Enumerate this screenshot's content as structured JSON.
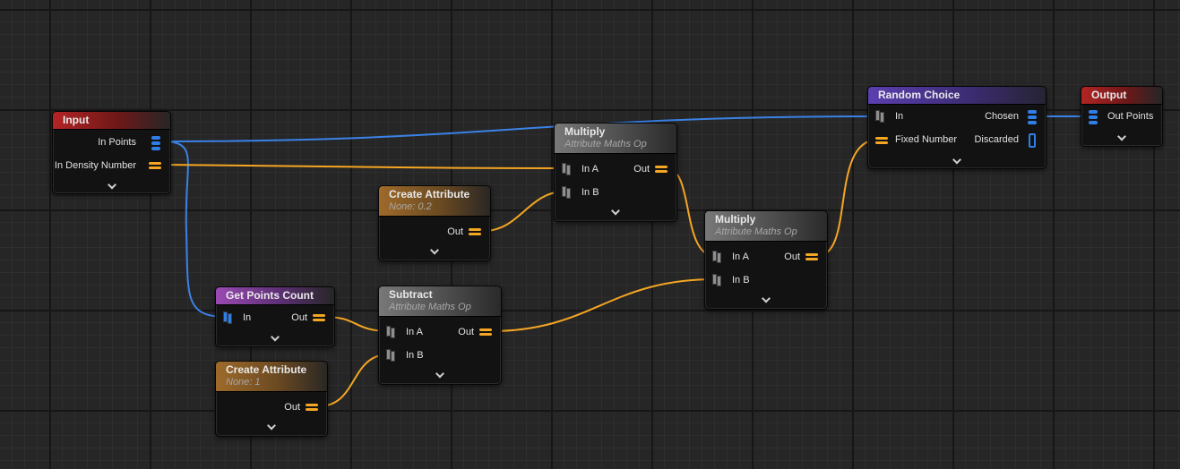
{
  "nodes": {
    "input": {
      "title": "Input",
      "pins": {
        "in_points": "In Points",
        "in_density": "In Density Number"
      }
    },
    "get_points_count": {
      "title": "Get Points Count",
      "pins": {
        "in": "In",
        "out": "Out"
      }
    },
    "create_attribute_1": {
      "title": "Create Attribute",
      "subtitle": "None: 0.2",
      "pins": {
        "out": "Out"
      }
    },
    "create_attribute_2": {
      "title": "Create Attribute",
      "subtitle": "None: 1",
      "pins": {
        "out": "Out"
      }
    },
    "subtract": {
      "title": "Subtract",
      "subtitle": "Attribute Maths Op",
      "pins": {
        "in_a": "In A",
        "in_b": "In B",
        "out": "Out"
      }
    },
    "multiply_1": {
      "title": "Multiply",
      "subtitle": "Attribute Maths Op",
      "pins": {
        "in_a": "In A",
        "in_b": "In B",
        "out": "Out"
      }
    },
    "multiply_2": {
      "title": "Multiply",
      "subtitle": "Attribute Maths Op",
      "pins": {
        "in_a": "In A",
        "in_b": "In B",
        "out": "Out"
      }
    },
    "random_choice": {
      "title": "Random Choice",
      "pins": {
        "in": "In",
        "fixed_number": "Fixed Number",
        "chosen": "Chosen",
        "discarded": "Discarded"
      }
    },
    "output": {
      "title": "Output",
      "pins": {
        "out_points": "Out Points"
      }
    }
  },
  "colors": {
    "point_wire": "#3b82e6",
    "attribute_wire": "#f5a623",
    "background": "#262626"
  }
}
